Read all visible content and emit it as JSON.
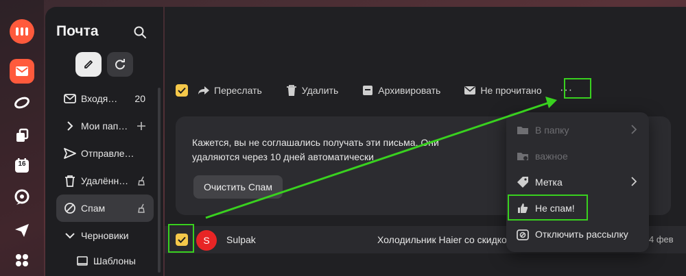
{
  "sidebar": {
    "title": "Почта",
    "items": [
      {
        "label": "Входя…",
        "count": "20"
      },
      {
        "label": "Мои пап…"
      },
      {
        "label": "Отправле…"
      },
      {
        "label": "Удалённ…"
      },
      {
        "label": "Спам"
      },
      {
        "label": "Черновики"
      },
      {
        "label": "Шаблоны"
      }
    ],
    "calendar_day": "16"
  },
  "toolbar": {
    "forward": "Переслать",
    "delete": "Удалить",
    "archive": "Архивировать",
    "unread": "Не прочитано",
    "more": "···"
  },
  "notice": {
    "text": "Кажется, вы не соглашались получать эти письма. Они удаляются через 10 дней автоматически",
    "clear_button": "Очистить Спам"
  },
  "mail": {
    "avatar_letter": "S",
    "sender": "Sulpak",
    "subject": "Холодильник Haier со скидкой",
    "date": "4 фев"
  },
  "menu": {
    "items": [
      {
        "label": "В папку",
        "state": "disabled"
      },
      {
        "label": "важное",
        "state": "disabled"
      },
      {
        "label": "Метка"
      },
      {
        "label": "Не спам!"
      },
      {
        "label": "Отключить рассылку"
      }
    ]
  },
  "colors": {
    "accent_orange": "#ff5a3c",
    "checkbox_yellow": "#f5c84a",
    "highlight_green": "#39d11f",
    "avatar_red": "#e82525"
  }
}
